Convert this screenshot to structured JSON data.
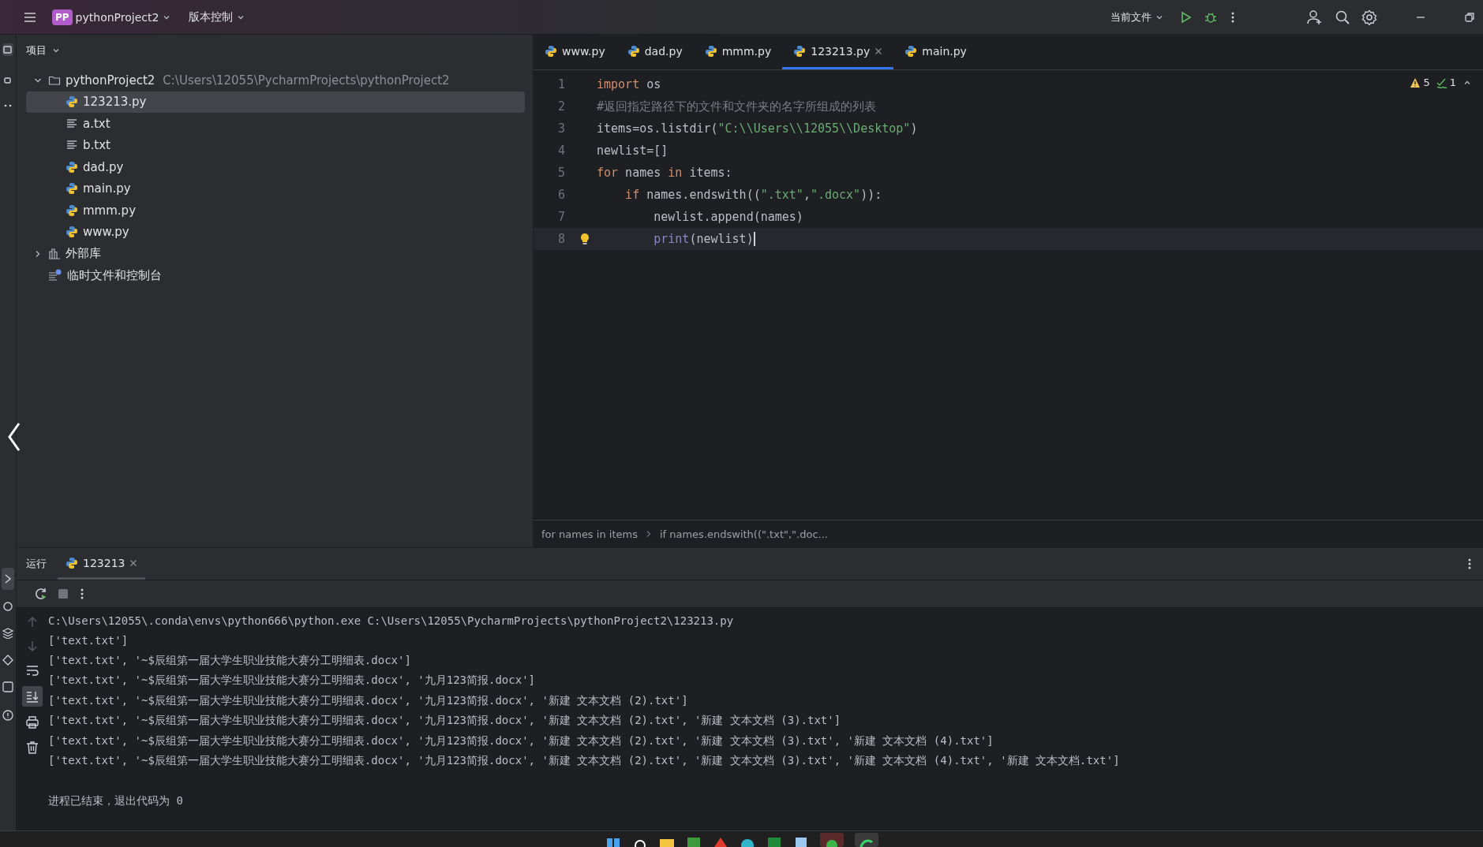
{
  "title_bar": {
    "project_badge": "PP",
    "project_name": "pythonProject2",
    "vcs_menu": "版本控制",
    "run_config": "当前文件"
  },
  "project_panel": {
    "title": "项目",
    "tree": [
      {
        "label": "pythonProject2",
        "path": "C:\\Users\\12055\\PycharmProjects\\pythonProject2",
        "kind": "folder",
        "expanded": true,
        "selected": false,
        "children": [
          {
            "label": "123213.py",
            "kind": "python",
            "selected": true
          },
          {
            "label": "a.txt",
            "kind": "text",
            "selected": false
          },
          {
            "label": "b.txt",
            "kind": "text",
            "selected": false
          },
          {
            "label": "dad.py",
            "kind": "python",
            "selected": false
          },
          {
            "label": "main.py",
            "kind": "python",
            "selected": false
          },
          {
            "label": "mmm.py",
            "kind": "python",
            "selected": false
          },
          {
            "label": "www.py",
            "kind": "python",
            "selected": false
          }
        ]
      },
      {
        "label": "外部库",
        "kind": "library",
        "expanded": false,
        "selected": false
      },
      {
        "label": "临时文件和控制台",
        "kind": "scratch",
        "selected": false
      }
    ]
  },
  "editor": {
    "tabs": [
      {
        "label": "www.py",
        "selected": false
      },
      {
        "label": "dad.py",
        "selected": false
      },
      {
        "label": "mmm.py",
        "selected": false
      },
      {
        "label": "123213.py",
        "selected": true
      },
      {
        "label": "main.py",
        "selected": false
      }
    ],
    "inspections": {
      "warnings": "5",
      "weak_warnings": "1"
    },
    "lines": [
      {
        "number": "1",
        "current": false,
        "tokens": [
          {
            "text": "import",
            "kind": "keyword"
          },
          {
            "text": " os",
            "kind": "plain"
          }
        ]
      },
      {
        "number": "2",
        "current": false,
        "tokens": [
          {
            "text": "#返回指定路径下的文件和文件夹的名字所组成的列表",
            "kind": "comment"
          }
        ]
      },
      {
        "number": "3",
        "current": false,
        "tokens": [
          {
            "text": "items=os.listdir(",
            "kind": "plain"
          },
          {
            "text": "\"C:\\\\Users\\\\12055\\\\Desktop\"",
            "kind": "string"
          },
          {
            "text": ")",
            "kind": "plain"
          }
        ]
      },
      {
        "number": "4",
        "current": false,
        "tokens": [
          {
            "text": "newlist=[]",
            "kind": "plain"
          }
        ]
      },
      {
        "number": "5",
        "current": false,
        "tokens": [
          {
            "text": "for",
            "kind": "keyword"
          },
          {
            "text": " names ",
            "kind": "plain"
          },
          {
            "text": "in",
            "kind": "keyword"
          },
          {
            "text": " items:",
            "kind": "plain"
          }
        ]
      },
      {
        "number": "6",
        "current": false,
        "tokens": [
          {
            "text": "    if",
            "kind": "keyword"
          },
          {
            "text": " names.endswith((",
            "kind": "plain"
          },
          {
            "text": "\".txt\"",
            "kind": "string"
          },
          {
            "text": ",",
            "kind": "plain"
          },
          {
            "text": "\".docx\"",
            "kind": "string"
          },
          {
            "text": ")):",
            "kind": "plain"
          }
        ]
      },
      {
        "number": "7",
        "current": false,
        "tokens": [
          {
            "text": "        newlist.append(names)",
            "kind": "plain"
          }
        ]
      },
      {
        "number": "8",
        "current": true,
        "tokens": [
          {
            "text": "        print",
            "kind": "builtin"
          },
          {
            "text": "(newlist)",
            "kind": "plain"
          }
        ]
      }
    ],
    "breadcrumbs": [
      "for names in items",
      "if names.endswith((\".txt\",\".doc..."
    ]
  },
  "run_panel": {
    "title": "运行",
    "tabs": [
      {
        "label": "123213",
        "selected": true
      }
    ],
    "console": [
      "C:\\Users\\12055\\.conda\\envs\\python666\\python.exe C:\\Users\\12055\\PycharmProjects\\pythonProject2\\123213.py",
      "['text.txt']",
      "['text.txt', '~$辰组第一届大学生职业技能大赛分工明细表.docx']",
      "['text.txt', '~$辰组第一届大学生职业技能大赛分工明细表.docx', '九月123简报.docx']",
      "['text.txt', '~$辰组第一届大学生职业技能大赛分工明细表.docx', '九月123简报.docx', '新建 文本文档 (2).txt']",
      "['text.txt', '~$辰组第一届大学生职业技能大赛分工明细表.docx', '九月123简报.docx', '新建 文本文档 (2).txt', '新建 文本文档 (3).txt']",
      "['text.txt', '~$辰组第一届大学生职业技能大赛分工明细表.docx', '九月123简报.docx', '新建 文本文档 (2).txt', '新建 文本文档 (3).txt', '新建 文本文档 (4).txt']",
      "['text.txt', '~$辰组第一届大学生职业技能大赛分工明细表.docx', '九月123简报.docx', '新建 文本文档 (2).txt', '新建 文本文档 (3).txt', '新建 文本文档 (4).txt', '新建 文本文档.txt']"
    ],
    "exit_message": "进程已结束，退出代码为 0"
  }
}
